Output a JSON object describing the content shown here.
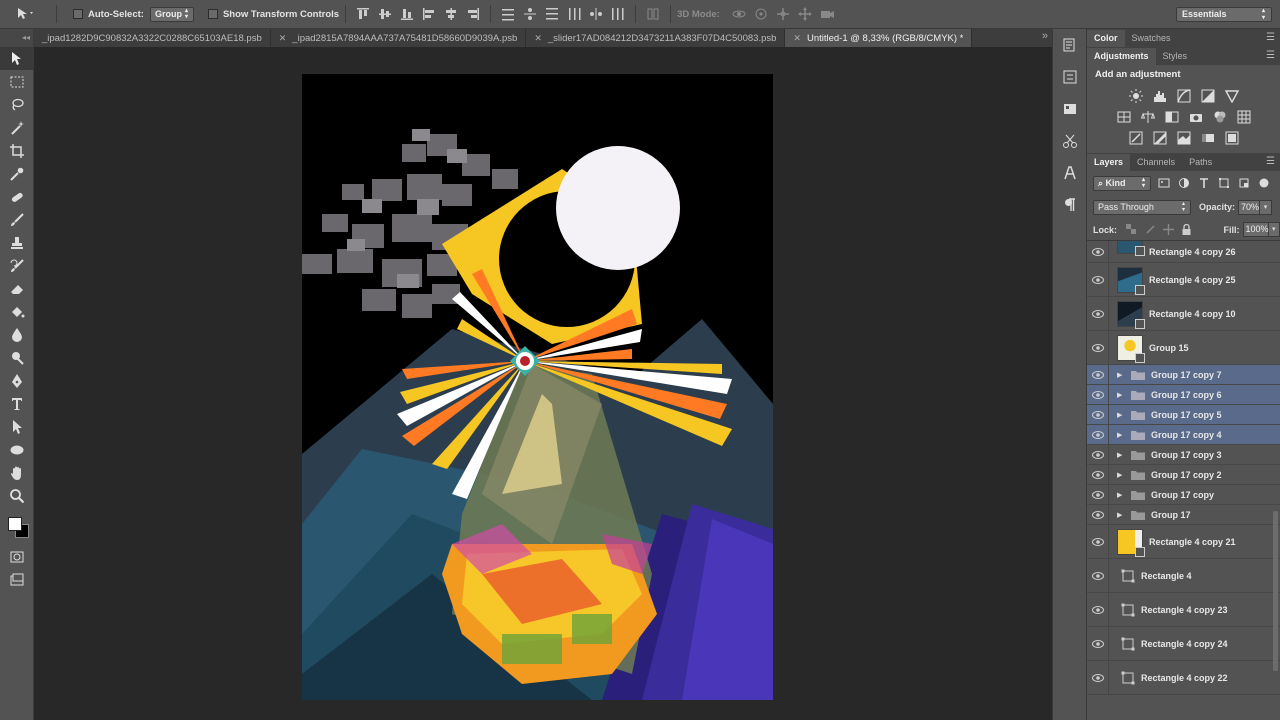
{
  "options_bar": {
    "auto_select_label": "Auto-Select:",
    "auto_select_value": "Group",
    "transform_controls_label": "Show Transform Controls",
    "mode_3d_label": "3D Mode:",
    "workspace": "Essentials"
  },
  "tabs": [
    {
      "label": "_ipad1282D9C90832A3322C0288C65103AE18.psb"
    },
    {
      "label": "_ipad2815A7894AAA737A75481D58660D9039A.psb"
    },
    {
      "label": "_slider17AD084212D3473211A383F07D4C50083.psb"
    },
    {
      "label": "Untitled-1 @ 8,33% (RGB/8/CMYK) *"
    }
  ],
  "color_panel": {
    "tabs": [
      "Color",
      "Swatches"
    ]
  },
  "adjustments_panel": {
    "tabs": [
      "Adjustments",
      "Styles"
    ],
    "title": "Add an adjustment"
  },
  "layers_panel": {
    "tabs": [
      "Layers",
      "Channels",
      "Paths"
    ],
    "kind_label": "Kind",
    "blend_mode": "Pass Through",
    "opacity_label": "Opacity:",
    "opacity_value": "70%",
    "lock_label": "Lock:",
    "fill_label": "Fill:",
    "fill_value": "100%",
    "layers": [
      {
        "name": "Rectangle 4 copy 26"
      },
      {
        "name": "Rectangle 4 copy 25"
      },
      {
        "name": "Rectangle 4 copy 10"
      },
      {
        "name": "Group 15"
      },
      {
        "name": "Group 17 copy 7"
      },
      {
        "name": "Group 17 copy 6"
      },
      {
        "name": "Group 17 copy 5"
      },
      {
        "name": "Group 17 copy 4"
      },
      {
        "name": "Group 17 copy 3"
      },
      {
        "name": "Group 17 copy 2"
      },
      {
        "name": "Group 17 copy"
      },
      {
        "name": "Group 17"
      },
      {
        "name": "Rectangle 4 copy 21"
      },
      {
        "name": "Rectangle 4"
      },
      {
        "name": "Rectangle 4 copy 23"
      },
      {
        "name": "Rectangle 4 copy 24"
      },
      {
        "name": "Rectangle 4 copy 22"
      }
    ]
  },
  "colors": {
    "selection": "#596a8a",
    "foreground": "#ffffff",
    "background": "#000000"
  }
}
